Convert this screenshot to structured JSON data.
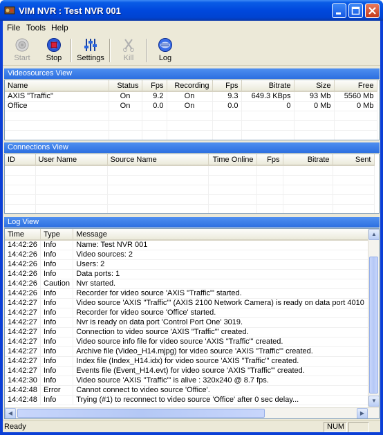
{
  "window": {
    "title": "VIM NVR : Test NVR 001"
  },
  "menu": [
    "File",
    "Tools",
    "Help"
  ],
  "toolbar": {
    "start": "Start",
    "stop": "Stop",
    "settings": "Settings",
    "kill": "Kill",
    "log": "Log"
  },
  "videosources": {
    "header": "Videosources View",
    "columns": [
      "Name",
      "Status",
      "Fps",
      "Recording",
      "Fps",
      "Bitrate",
      "Size",
      "Free"
    ],
    "rows": [
      [
        "AXIS \"Traffic\"",
        "On",
        "9.2",
        "On",
        "9.3",
        "649.3 KBps",
        "93 Mb",
        "5560 Mb"
      ],
      [
        "Office",
        "On",
        "0.0",
        "On",
        "0.0",
        "0",
        "0 Mb",
        "0 Mb"
      ]
    ]
  },
  "connections": {
    "header": "Connections View",
    "columns": [
      "ID",
      "User Name",
      "Source Name",
      "Time Online",
      "Fps",
      "Bitrate",
      "Sent"
    ],
    "rows": []
  },
  "log": {
    "header": "Log View",
    "columns": [
      "Time",
      "Type",
      "Message"
    ],
    "rows": [
      [
        "14:42:26",
        "Info",
        "Name: Test NVR 001"
      ],
      [
        "14:42:26",
        "Info",
        "Video sources: 2"
      ],
      [
        "14:42:26",
        "Info",
        "Users: 2"
      ],
      [
        "14:42:26",
        "Info",
        "Data ports: 1"
      ],
      [
        "14:42:26",
        "Caution",
        "Nvr started."
      ],
      [
        "14:42:26",
        "Info",
        "Recorder for video source 'AXIS \"Traffic\"' started."
      ],
      [
        "14:42:27",
        "Info",
        "Video source 'AXIS \"Traffic\"' (AXIS 2100 Network Camera) is ready on data port 4010"
      ],
      [
        "14:42:27",
        "Info",
        "Recorder for video source 'Office' started."
      ],
      [
        "14:42:27",
        "Info",
        "Nvr is ready on data port 'Control Port One' 3019."
      ],
      [
        "14:42:27",
        "Info",
        "Connection to video source 'AXIS \"Traffic\"' created."
      ],
      [
        "14:42:27",
        "Info",
        "Video source info file for video source 'AXIS \"Traffic\"' created."
      ],
      [
        "14:42:27",
        "Info",
        "Archive file (Video_H14.mjpg) for video source 'AXIS \"Traffic\"' created."
      ],
      [
        "14:42:27",
        "Info",
        "Index file (Index_H14.idx) for video source 'AXIS \"Traffic\"' created."
      ],
      [
        "14:42:27",
        "Info",
        "Events file (Event_H14.evt) for video source 'AXIS \"Traffic\"' created."
      ],
      [
        "14:42:30",
        "Info",
        "Video source 'AXIS \"Traffic\"' is alive : 320x240 @ 8.7 fps."
      ],
      [
        "14:42:48",
        "Error",
        "Cannot connect to video source 'Office'."
      ],
      [
        "14:42:48",
        "Info",
        "Trying (#1) to reconnect to video source 'Office' after 0 sec delay..."
      ]
    ]
  },
  "status": {
    "text": "Ready",
    "num": "NUM"
  }
}
